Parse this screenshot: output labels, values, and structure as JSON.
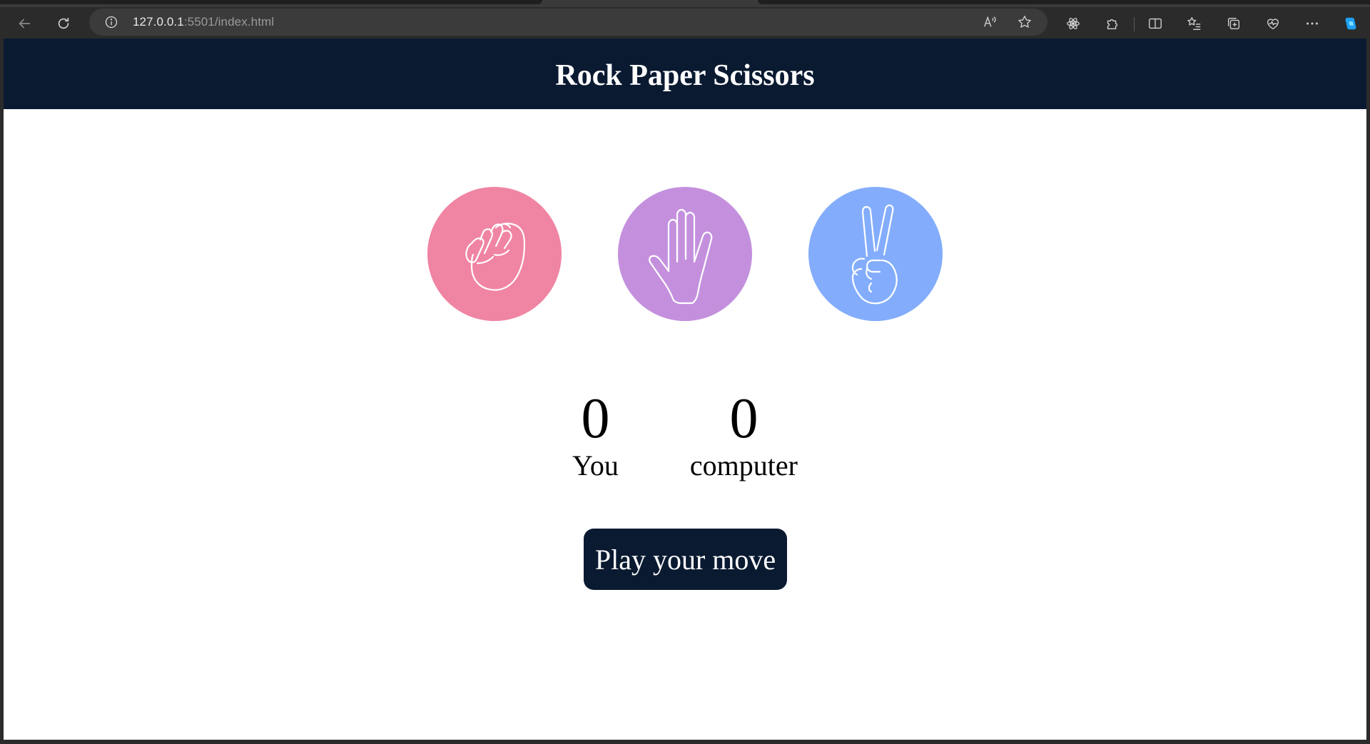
{
  "browser": {
    "url_host": "127.0.0.1",
    "url_rest": ":5501/index.html"
  },
  "page": {
    "title": "Rock Paper Scissors",
    "choices": [
      {
        "name": "rock",
        "color": "#f084a3"
      },
      {
        "name": "paper",
        "color": "#c490de"
      },
      {
        "name": "scissors",
        "color": "#83adfc"
      }
    ],
    "score": {
      "user_score": "0",
      "user_label": "You",
      "computer_score": "0",
      "computer_label": "computer"
    },
    "play_button": "Play your move",
    "colors": {
      "header_bg": "#0a1a31",
      "button_bg": "#0a1a31"
    }
  }
}
